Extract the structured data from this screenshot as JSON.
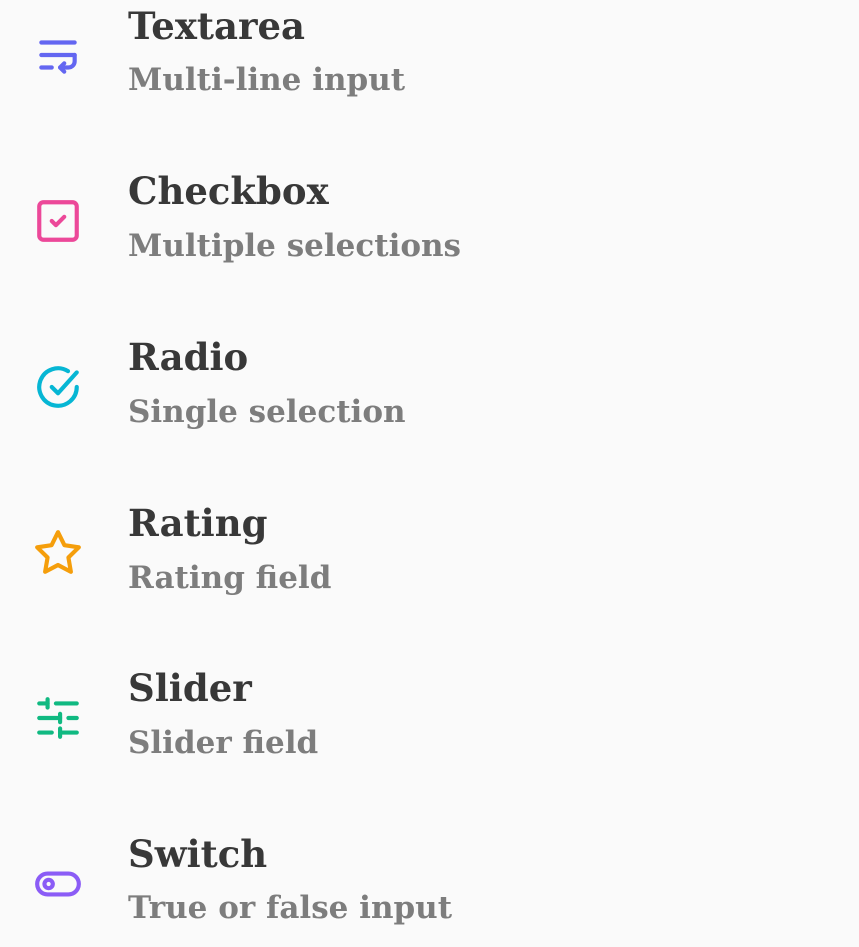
{
  "items": [
    {
      "title": "Textarea",
      "description": "Multi-line input",
      "icon": "text-wrap-icon",
      "color": "#6366f1"
    },
    {
      "title": "Checkbox",
      "description": "Multiple selections",
      "icon": "checkbox-icon",
      "color": "#ec4899"
    },
    {
      "title": "Radio",
      "description": "Single selection",
      "icon": "circle-check-icon",
      "color": "#06b6d4"
    },
    {
      "title": "Rating",
      "description": "Rating field",
      "icon": "star-icon",
      "color": "#f59e0b"
    },
    {
      "title": "Slider",
      "description": "Slider field",
      "icon": "sliders-icon",
      "color": "#10b981"
    },
    {
      "title": "Switch",
      "description": "True or false input",
      "icon": "toggle-icon",
      "color": "#8b5cf6"
    }
  ]
}
